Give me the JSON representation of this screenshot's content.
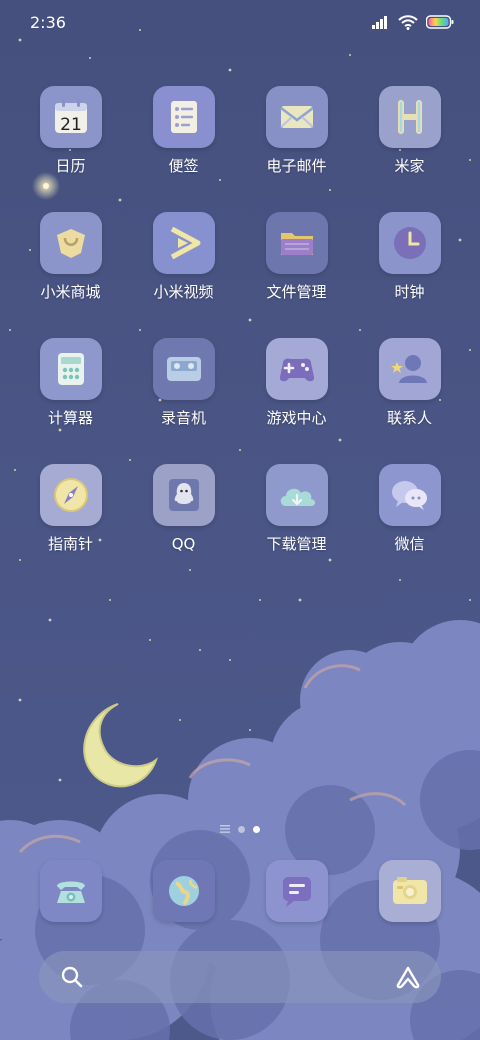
{
  "status_bar": {
    "time": "2:36",
    "icons": [
      "signal-icon",
      "wifi-icon",
      "battery-icon"
    ]
  },
  "apps": [
    {
      "label": "日历",
      "icon": "calendar-icon",
      "badge_text": "21",
      "bg": "#8b95c9"
    },
    {
      "label": "便签",
      "icon": "notes-icon",
      "bg": "#8a90cf"
    },
    {
      "label": "电子邮件",
      "icon": "mail-icon",
      "bg": "#8891c6"
    },
    {
      "label": "米家",
      "icon": "mijia-icon",
      "bg": "#9aa2cc"
    },
    {
      "label": "小米商城",
      "icon": "store-icon",
      "bg": "#8b95c9"
    },
    {
      "label": "小米视频",
      "icon": "video-icon",
      "bg": "#8791d0"
    },
    {
      "label": "文件管理",
      "icon": "folder-icon",
      "bg": "#6d77ae"
    },
    {
      "label": "时钟",
      "icon": "clock-icon",
      "bg": "#8c94cc"
    },
    {
      "label": "计算器",
      "icon": "calculator-icon",
      "bg": "#8e98cc"
    },
    {
      "label": "录音机",
      "icon": "recorder-icon",
      "bg": "#6f79b0"
    },
    {
      "label": "游戏中心",
      "icon": "gamepad-icon",
      "bg": "#a4a9d6"
    },
    {
      "label": "联系人",
      "icon": "contacts-icon",
      "bg": "#a1a6d4"
    },
    {
      "label": "指南针",
      "icon": "compass-icon",
      "bg": "#a5abd2"
    },
    {
      "label": "QQ",
      "icon": "qq-icon",
      "bg": "#9ba1c7"
    },
    {
      "label": "下载管理",
      "icon": "cloud-download-icon",
      "bg": "#8f99cc"
    },
    {
      "label": "微信",
      "icon": "wechat-icon",
      "bg": "#8e96d0"
    }
  ],
  "dock": [
    {
      "icon": "phone-icon",
      "bg": "#7f88c4"
    },
    {
      "icon": "browser-icon",
      "bg": "#6f78b4"
    },
    {
      "icon": "messages-icon",
      "bg": "#8d93cf"
    },
    {
      "icon": "camera-icon",
      "bg": "#a9aed4"
    }
  ],
  "page_indicator": {
    "pages": 2,
    "active": 1
  },
  "search_bar": {
    "left_icon": "search-icon",
    "right_icon": "assistant-icon"
  }
}
